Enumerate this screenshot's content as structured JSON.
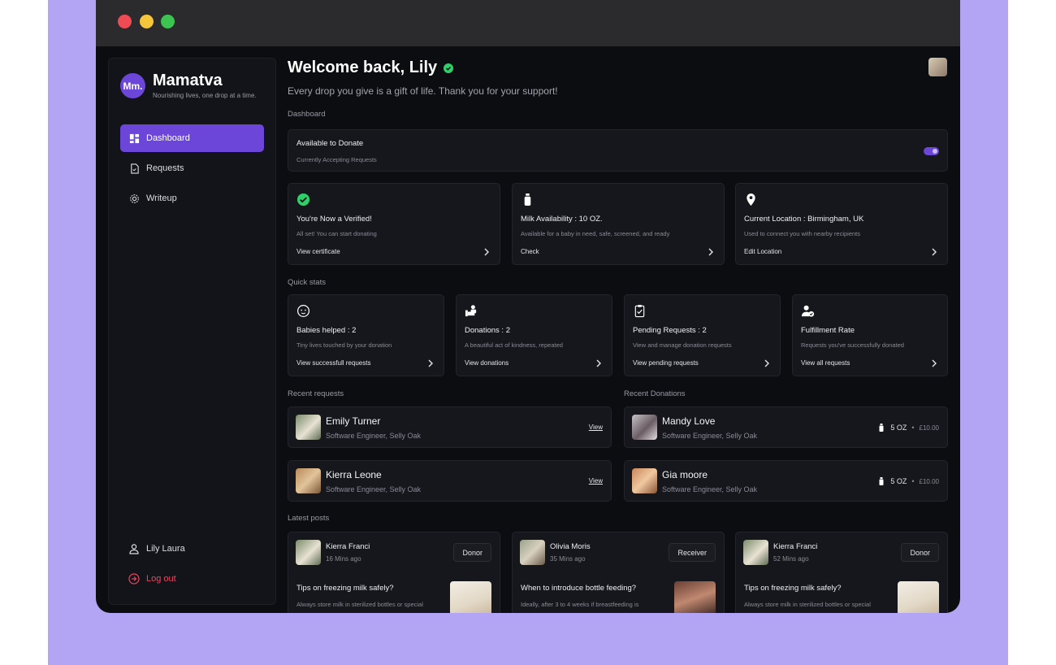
{
  "brand": {
    "badge": "Mm.",
    "name": "Mamatva",
    "tagline": "Nourishing lives, one drop at a time."
  },
  "nav": [
    {
      "label": "Dashboard",
      "icon": "dashboard-icon",
      "active": true
    },
    {
      "label": "Requests",
      "icon": "document-icon",
      "active": false
    },
    {
      "label": "Writeup",
      "icon": "gear-icon",
      "active": false
    }
  ],
  "sidebar_footer": {
    "user": "Lily Laura",
    "logout": "Log out"
  },
  "header": {
    "welcome": "Welcome back, Lily",
    "subtitle": "Every drop you give is a gift of life. Thank you for your support!"
  },
  "sections": {
    "dashboard": "Dashboard",
    "quick_stats": "Quick stats",
    "recent_requests": "Recent requests",
    "recent_donations": "Recent Donations",
    "latest_posts": "Latest posts"
  },
  "donate": {
    "title": "Available to Donate",
    "status": "Currently Accepting Requests",
    "enabled": true
  },
  "status_cards": [
    {
      "title": "You're Now a Verified!",
      "sub": "All set! You can start donating",
      "link": "View certificate",
      "icon": "check-circle-icon"
    },
    {
      "title": "Milk Availability : 10 OZ.",
      "sub": "Available for a baby in need, safe, screened, and ready",
      "link": "Check",
      "icon": "bottle-icon"
    },
    {
      "title": "Current Location : Birmingham, UK",
      "sub": "Used to connect you with nearby recipients",
      "link": "Edit Location",
      "icon": "location-pin-icon"
    }
  ],
  "stats": [
    {
      "title": "Babies helped : 2",
      "sub": "Tiny lives touched by your donation",
      "link": "View successfull requests",
      "icon": "baby-icon"
    },
    {
      "title": "Donations : 2",
      "sub": "A beautiful act of kindness, repeated",
      "link": "View donations",
      "icon": "donation-hand-icon"
    },
    {
      "title": "Pending Requests : 2",
      "sub": "View and manage donation requests",
      "link": "View pending requests",
      "icon": "clipboard-check-icon"
    },
    {
      "title": "Fulfillment Rate",
      "sub": "Requests you've successfully donated",
      "link": "View all requests",
      "icon": "user-check-icon"
    }
  ],
  "requests": [
    {
      "name": "Emily Turner",
      "role": "Software Engineer, Selly Oak",
      "action": "View"
    },
    {
      "name": "Kierra Leone",
      "role": "Software Engineer, Selly Oak",
      "action": "View"
    }
  ],
  "donations": [
    {
      "name": "Mandy Love",
      "role": "Software Engineer, Selly Oak",
      "amount": "5 OZ",
      "price": "£10.00"
    },
    {
      "name": "Gia moore",
      "role": "Software Engineer, Selly Oak",
      "amount": "5 OZ",
      "price": "£10.00"
    }
  ],
  "posts": [
    {
      "name": "Kierra Franci",
      "time": "16 Mins ago",
      "tag": "Donor",
      "question": "Tips on freezing milk safely?",
      "body": "Always store milk in sterilized bottles or special"
    },
    {
      "name": "Olivia Moris",
      "time": "35 Mins ago",
      "tag": "Receiver",
      "question": "When to introduce bottle feeding?",
      "body": "Ideally, after 3 to 4 weeks if breastfeeding is"
    },
    {
      "name": "Kierra Franci",
      "time": "52 Mins ago",
      "tag": "Donor",
      "question": "Tips on freezing milk safely?",
      "body": "Always store milk in sterilized bottles or special"
    }
  ],
  "colors": {
    "accent": "#6b46d8",
    "background": "#b3a5f4",
    "logout": "#f0445e",
    "verified": "#2fcf6a"
  }
}
